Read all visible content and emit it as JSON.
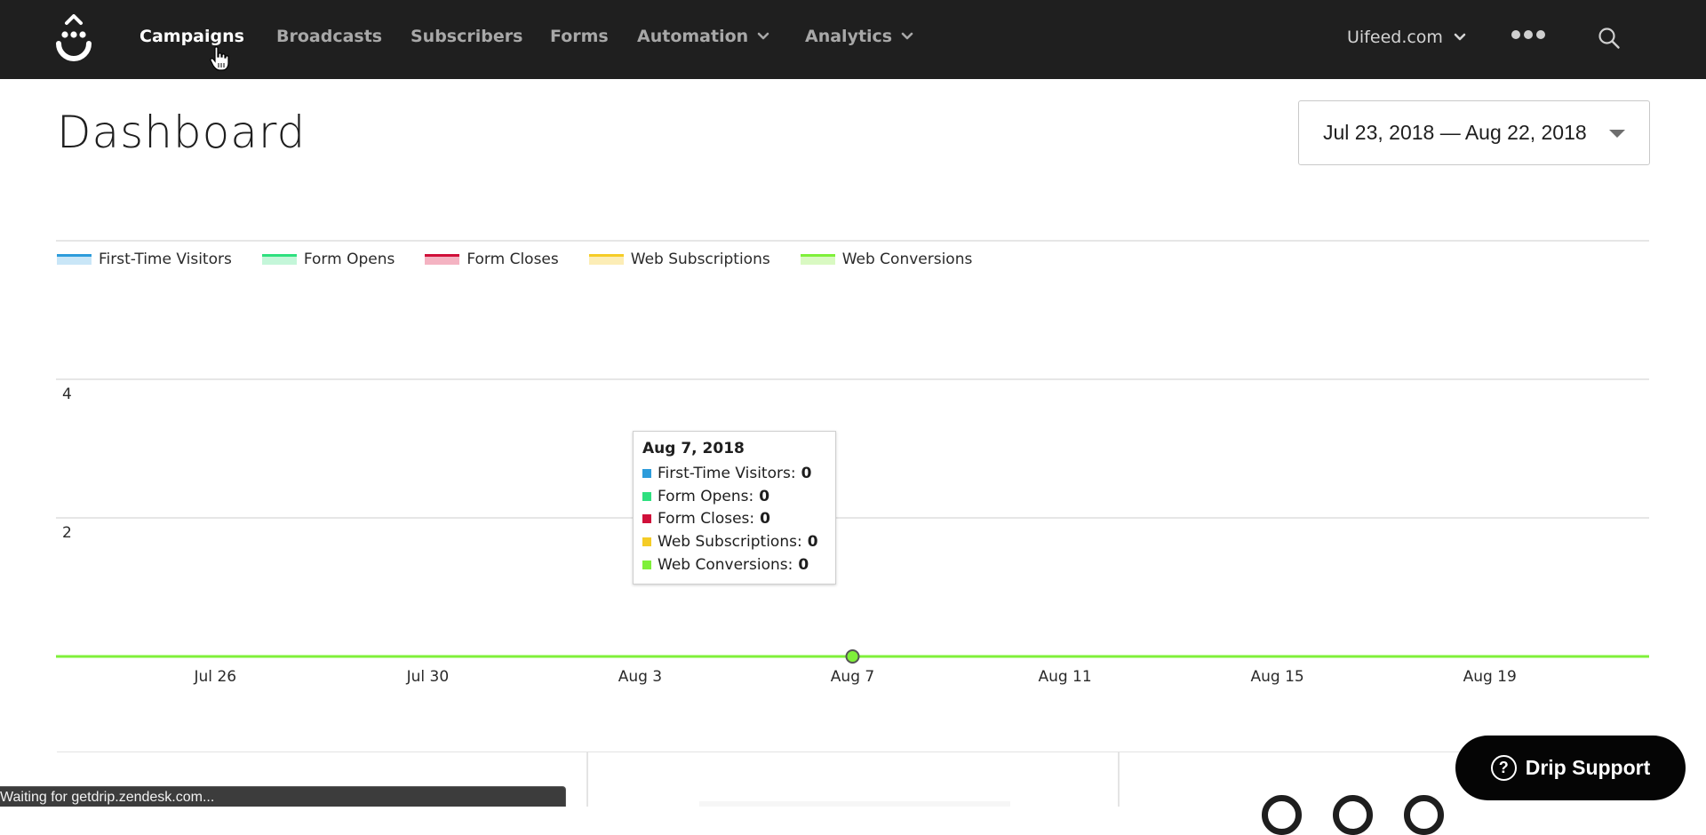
{
  "nav": {
    "items": [
      {
        "label": "Campaigns",
        "active": true,
        "has_dropdown": false
      },
      {
        "label": "Broadcasts",
        "active": false,
        "has_dropdown": false
      },
      {
        "label": "Subscribers",
        "active": false,
        "has_dropdown": false
      },
      {
        "label": "Forms",
        "active": false,
        "has_dropdown": false
      },
      {
        "label": "Automation",
        "active": false,
        "has_dropdown": true
      },
      {
        "label": "Analytics",
        "active": false,
        "has_dropdown": true
      }
    ],
    "account": "Uifeed.com",
    "icons": {
      "logo": "drip-logo",
      "more": "more-dots-icon",
      "search": "search-icon",
      "chevron": "chevron-down-icon"
    }
  },
  "header": {
    "title": "Dashboard",
    "date_range": "Jul 23, 2018 — Aug 22, 2018"
  },
  "chart_data": {
    "type": "line",
    "title": "",
    "xlabel": "",
    "ylabel": "",
    "x_start": "Jul 23, 2018",
    "x_end": "Aug 22, 2018",
    "x_range_days": [
      0,
      30
    ],
    "x_ticks": [
      {
        "label": "Jul 26",
        "day": 3
      },
      {
        "label": "Jul 30",
        "day": 7
      },
      {
        "label": "Aug 3",
        "day": 11
      },
      {
        "label": "Aug 7",
        "day": 15
      },
      {
        "label": "Aug 11",
        "day": 19
      },
      {
        "label": "Aug 15",
        "day": 23
      },
      {
        "label": "Aug 19",
        "day": 27
      }
    ],
    "ylim": [
      0,
      6
    ],
    "y_gridlines": [
      0,
      2,
      4,
      6
    ],
    "y_tick_labels": [
      {
        "label": "4",
        "value": 4
      },
      {
        "label": "2",
        "value": 2
      }
    ],
    "grid": true,
    "legend_position": "top-left",
    "series": [
      {
        "name": "First-Time Visitors",
        "color": "#2d9cdb",
        "fill": "#c9e6f7",
        "values": [
          0,
          0,
          0,
          0,
          0,
          0,
          0,
          0,
          0,
          0,
          0,
          0,
          0,
          0,
          0,
          0,
          0,
          0,
          0,
          0,
          0,
          0,
          0,
          0,
          0,
          0,
          0,
          0,
          0,
          0,
          0
        ]
      },
      {
        "name": "Form Opens",
        "color": "#2ee07f",
        "fill": "#c4f6d9",
        "values": [
          0,
          0,
          0,
          0,
          0,
          0,
          0,
          0,
          0,
          0,
          0,
          0,
          0,
          0,
          0,
          0,
          0,
          0,
          0,
          0,
          0,
          0,
          0,
          0,
          0,
          0,
          0,
          0,
          0,
          0,
          0
        ]
      },
      {
        "name": "Form Closes",
        "color": "#d0103a",
        "fill": "#f4b3c2",
        "values": [
          0,
          0,
          0,
          0,
          0,
          0,
          0,
          0,
          0,
          0,
          0,
          0,
          0,
          0,
          0,
          0,
          0,
          0,
          0,
          0,
          0,
          0,
          0,
          0,
          0,
          0,
          0,
          0,
          0,
          0,
          0
        ]
      },
      {
        "name": "Web Subscriptions",
        "color": "#f5cc26",
        "fill": "#fcedb6",
        "values": [
          0,
          0,
          0,
          0,
          0,
          0,
          0,
          0,
          0,
          0,
          0,
          0,
          0,
          0,
          0,
          0,
          0,
          0,
          0,
          0,
          0,
          0,
          0,
          0,
          0,
          0,
          0,
          0,
          0,
          0,
          0
        ]
      },
      {
        "name": "Web Conversions",
        "color": "#7ff03a",
        "fill": "#d9f9c2",
        "values": [
          0,
          0,
          0,
          0,
          0,
          0,
          0,
          0,
          0,
          0,
          0,
          0,
          0,
          0,
          0,
          0,
          0,
          0,
          0,
          0,
          0,
          0,
          0,
          0,
          0,
          0,
          0,
          0,
          0,
          0,
          0
        ]
      }
    ],
    "hover": {
      "day": 15,
      "date_label": "Aug 7, 2018",
      "rows": [
        {
          "name": "First-Time Visitors:",
          "value": "0",
          "color": "#2d9cdb"
        },
        {
          "name": "Form Opens:",
          "value": "0",
          "color": "#2ee07f"
        },
        {
          "name": "Form Closes:",
          "value": "0",
          "color": "#d0103a"
        },
        {
          "name": "Web Subscriptions:",
          "value": "0",
          "color": "#f5cc26"
        },
        {
          "name": "Web Conversions:",
          "value": "0",
          "color": "#7ff03a"
        }
      ]
    }
  },
  "status_bar": "Waiting for getdrip.zendesk.com...",
  "support": {
    "label": "Drip Support",
    "icon": "help-icon",
    "icon_glyph": "?"
  }
}
